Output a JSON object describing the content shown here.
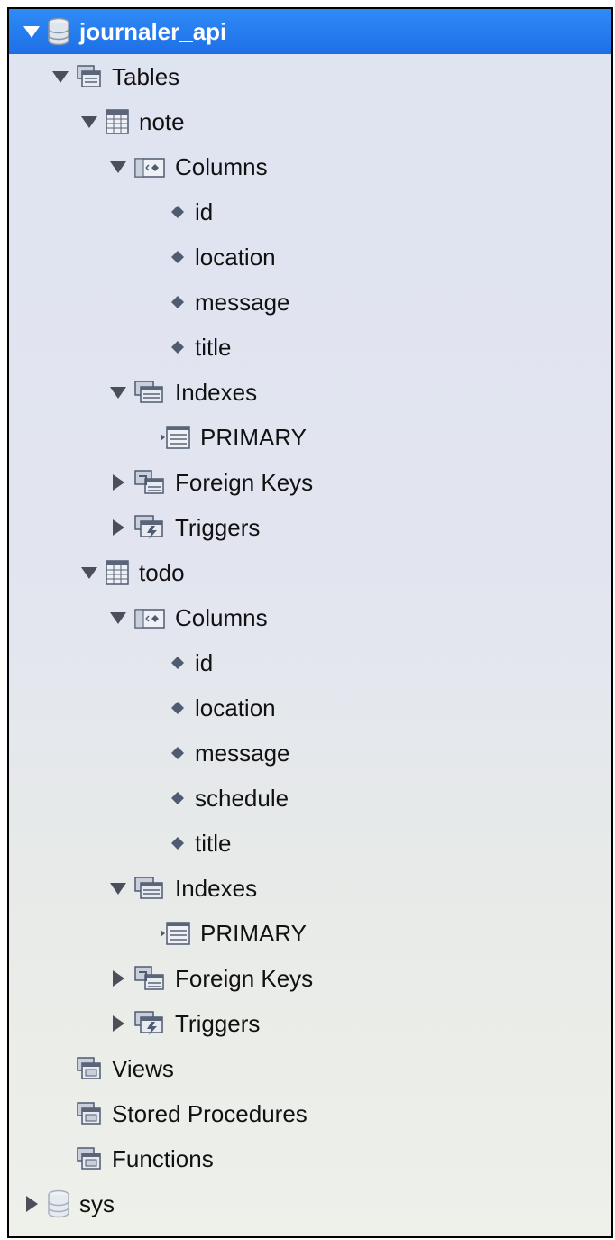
{
  "tree": {
    "schema": {
      "label": "journaler_api",
      "icon": "database-icon",
      "expanded": true,
      "selected": true
    },
    "tables_folder": {
      "label": "Tables",
      "icon": "folder-stack-icon",
      "expanded": true
    },
    "tables": [
      {
        "label": "note",
        "icon": "table-icon",
        "expanded": true,
        "columns_label": "Columns",
        "columns": [
          "id",
          "location",
          "message",
          "title"
        ],
        "indexes_label": "Indexes",
        "indexes": [
          "PRIMARY"
        ],
        "foreign_keys_label": "Foreign Keys",
        "triggers_label": "Triggers"
      },
      {
        "label": "todo",
        "icon": "table-icon",
        "expanded": true,
        "columns_label": "Columns",
        "columns": [
          "id",
          "location",
          "message",
          "schedule",
          "title"
        ],
        "indexes_label": "Indexes",
        "indexes": [
          "PRIMARY"
        ],
        "foreign_keys_label": "Foreign Keys",
        "triggers_label": "Triggers"
      }
    ],
    "views_label": "Views",
    "stored_procedures_label": "Stored Procedures",
    "functions_label": "Functions",
    "other_schema": {
      "label": "sys",
      "icon": "database-icon",
      "expanded": false
    }
  },
  "colors": {
    "selection": "#2f8bf6",
    "icon_slate": "#5b6578",
    "background_top": "#dfe4f1",
    "background_bottom": "#eef0ea"
  }
}
